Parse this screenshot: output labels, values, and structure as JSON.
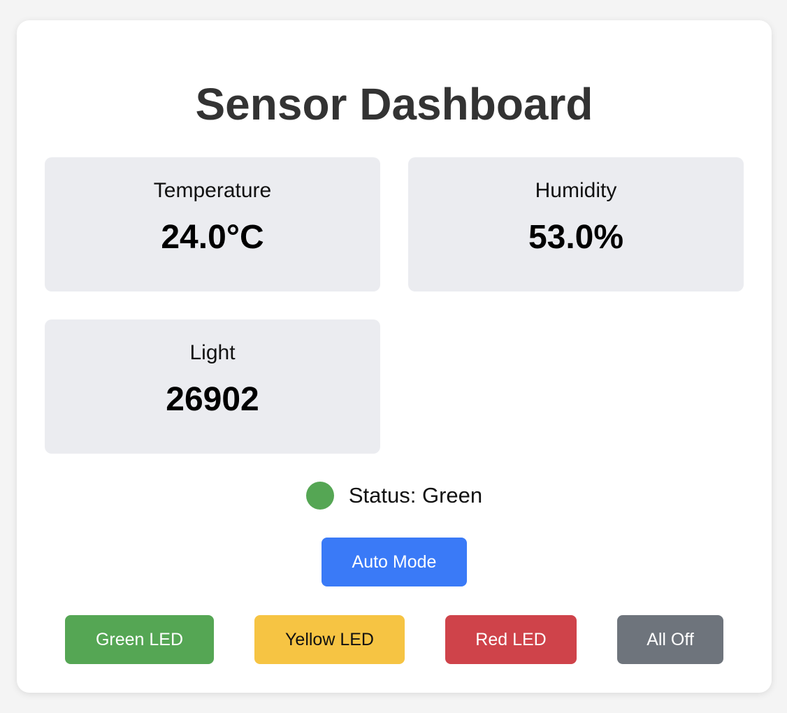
{
  "title": "Sensor Dashboard",
  "sensors": {
    "temperature": {
      "label": "Temperature",
      "value": "24.0°C"
    },
    "humidity": {
      "label": "Humidity",
      "value": "53.0%"
    },
    "light": {
      "label": "Light",
      "value": "26902"
    }
  },
  "status": {
    "text": "Status: Green",
    "color": "#55a654"
  },
  "buttons": {
    "auto": {
      "label": "Auto Mode",
      "color": "#3a7af7"
    },
    "green": {
      "label": "Green LED",
      "color": "#55a654"
    },
    "yellow": {
      "label": "Yellow LED",
      "color": "#f6c443"
    },
    "red": {
      "label": "Red LED",
      "color": "#cf434a"
    },
    "off": {
      "label": "All Off",
      "color": "#6e747c"
    }
  }
}
